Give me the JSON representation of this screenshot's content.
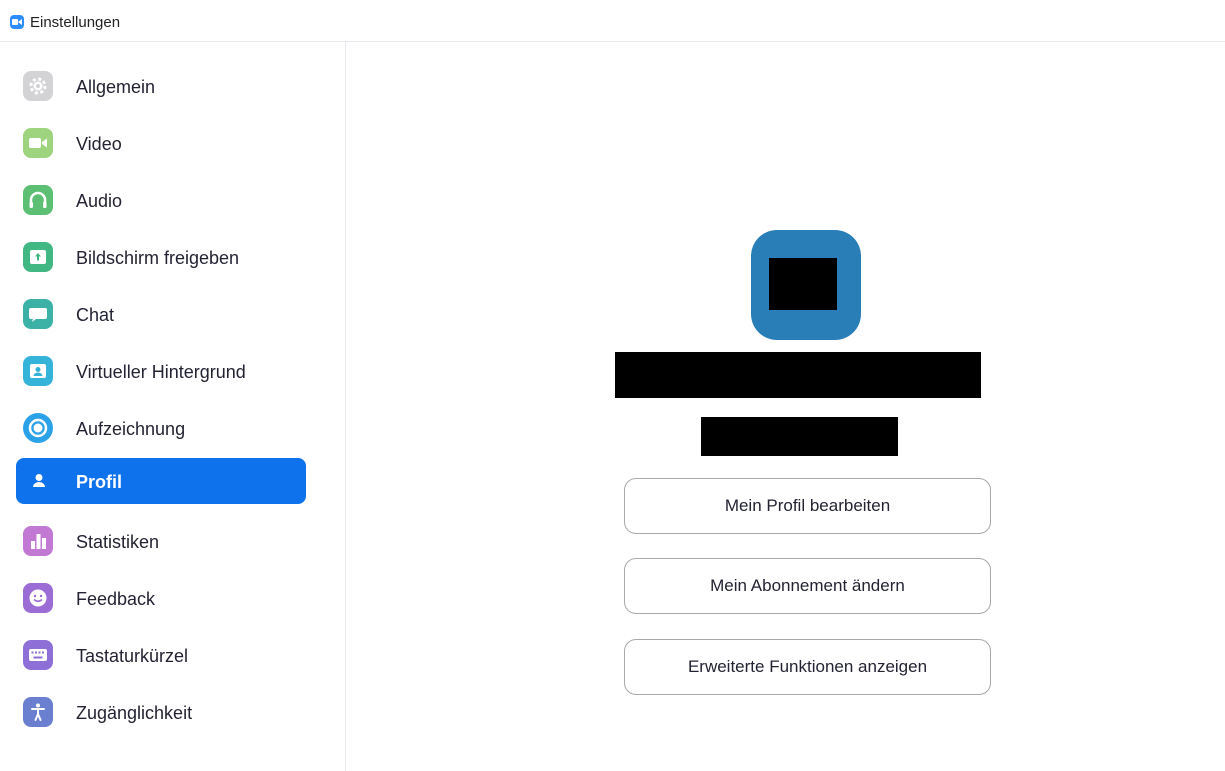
{
  "window": {
    "title": "Einstellungen",
    "logo_icon": "zoom-camera-icon",
    "logo_color": "#2d8cff"
  },
  "sidebar": {
    "items": [
      {
        "label": "Allgemein",
        "icon": "gear-icon",
        "color": "#d3d3d6",
        "active": false
      },
      {
        "label": "Video",
        "icon": "video-camera-icon",
        "color": "#9ed47e",
        "active": false
      },
      {
        "label": "Audio",
        "icon": "headphones-icon",
        "color": "#5cbf73",
        "active": false
      },
      {
        "label": "Bildschirm freigeben",
        "icon": "share-screen-icon",
        "color": "#41b883",
        "active": false
      },
      {
        "label": "Chat",
        "icon": "chat-bubble-icon",
        "color": "#3cb1a6",
        "active": false
      },
      {
        "label": "Virtueller Hintergrund",
        "icon": "virtual-background-icon",
        "color": "#36b3d9",
        "active": false
      },
      {
        "label": "Aufzeichnung",
        "icon": "record-icon",
        "color": "#2ba2e8",
        "active": false
      },
      {
        "label": "Profil",
        "icon": "person-icon",
        "color": "#0e72ed",
        "active": true
      },
      {
        "label": "Statistiken",
        "icon": "bar-chart-icon",
        "color": "#c179d3",
        "active": false
      },
      {
        "label": "Feedback",
        "icon": "smiley-icon",
        "color": "#9b6bd6",
        "active": false
      },
      {
        "label": "Tastaturkürzel",
        "icon": "keyboard-icon",
        "color": "#8e6fd8",
        "active": false
      },
      {
        "label": "Zugänglichkeit",
        "icon": "accessibility-icon",
        "color": "#6a7fcf",
        "active": false
      }
    ]
  },
  "profile": {
    "avatar_color": "#2a7eb8",
    "buttons": {
      "edit_profile": "Mein Profil bearbeiten",
      "change_subscription": "Mein Abonnement ändern",
      "advanced_features": "Erweiterte Funktionen anzeigen"
    }
  }
}
